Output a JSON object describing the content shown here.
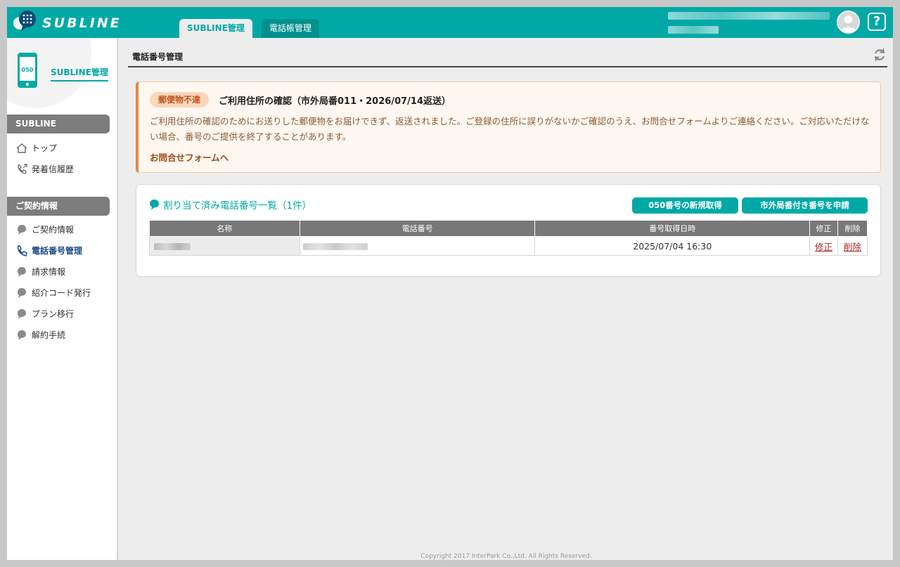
{
  "header": {
    "brand": "SUBLINE",
    "tabs": [
      {
        "label": "SUBLINE管理",
        "active": true
      },
      {
        "label": "電話帳管理",
        "active": false
      }
    ],
    "help_glyph": "?",
    "icons": {
      "avatar": "user-avatar-icon",
      "help": "question-icon",
      "logo": "chat-bubble-logo-icon"
    }
  },
  "sidebar": {
    "title": "SUBLINE管理",
    "phone_icon_text": "050",
    "section1": {
      "heading": "SUBLINE",
      "items": [
        {
          "label": "トップ",
          "icon": "home-icon"
        },
        {
          "label": "発着信履歴",
          "icon": "phone-history-icon"
        }
      ]
    },
    "section2": {
      "heading": "ご契約情報",
      "items": [
        {
          "label": "ご契約情報",
          "icon": "bubble-icon"
        },
        {
          "label": "電話番号管理",
          "icon": "phone-icon",
          "active": true
        },
        {
          "label": "請求情報",
          "icon": "bubble-icon"
        },
        {
          "label": "紹介コード発行",
          "icon": "bubble-icon"
        },
        {
          "label": "プラン移行",
          "icon": "bubble-icon"
        },
        {
          "label": "解約手続",
          "icon": "bubble-icon"
        }
      ]
    }
  },
  "main": {
    "page_title": "電話番号管理",
    "notice": {
      "badge": "郵便物不達",
      "title": "ご利用住所の確認（市外局番011・2026/07/14返送）",
      "body": "ご利用住所の確認のためにお送りした郵便物をお届けできず、返送されました。ご登録の住所に誤りがないかご確認のうえ、お問合せフォームよりご連絡ください。ご対応いただけない場合、番号のご提供を終了することがあります。",
      "link": "お問合せフォームへ"
    },
    "panel": {
      "title": "割り当て済み電話番号一覧（1件）",
      "btn_new": "050番号の新規取得",
      "btn_apply": "市外局番付き番号を申請",
      "columns": [
        "名称",
        "電話番号",
        "番号取得日時",
        "修正",
        "削除"
      ],
      "rows": [
        {
          "acquired": "2025/07/04 16:30",
          "edit": "修正",
          "delete": "削除"
        }
      ]
    },
    "copyright": "Copyright 2017 InterPark Co.,Ltd. All Rights Reserved."
  },
  "colors": {
    "accent": "#00a9a6",
    "notice_border": "#e08a47",
    "link_red": "#a32424",
    "active_nav": "#1b4a8a"
  }
}
